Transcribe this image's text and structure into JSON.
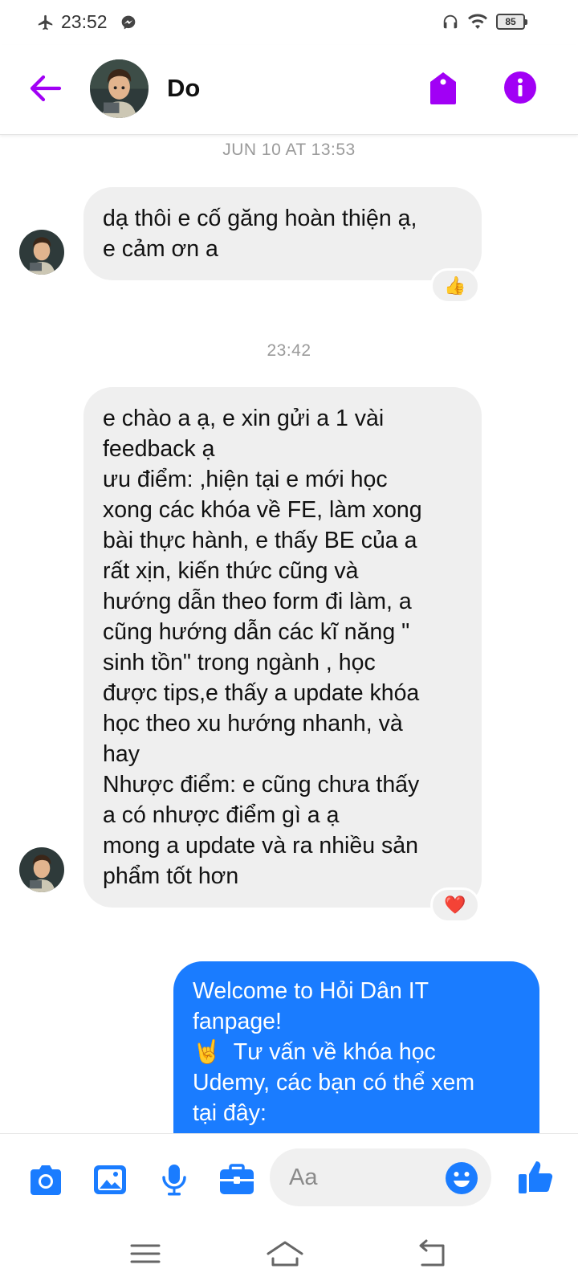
{
  "status_bar": {
    "time": "23:52",
    "battery": "85",
    "icons": [
      "airplane-icon",
      "messenger-icon",
      "headphones-icon",
      "wifi-icon",
      "battery-icon"
    ]
  },
  "header": {
    "contact_name": "Do",
    "accent_color": "#a100f5",
    "icons": [
      "back-arrow-icon",
      "tag-icon",
      "info-icon"
    ]
  },
  "conversation": {
    "timestamp_1": "JUN 10 AT 13:53",
    "message_1": "dạ thôi e cố găng hoàn thiện ạ,\ne cảm ơn a",
    "reaction_1": "👍",
    "timestamp_2": "23:42",
    "message_2": "e chào a ạ, e xin gửi a 1 vài\nfeedback ạ\nưu điểm: ,hiện tại e mới học\nxong các khóa về FE, làm xong\nbài thực hành, e thấy BE của a\nrất xịn, kiến thức cũng và\nhướng dẫn theo form đi làm, a\ncũng hướng dẫn các kĩ năng \"\nsinh tồn\" trong ngành , học\nđược tips,e thấy a update khóa\nhọc theo xu hướng nhanh, và\nhay\nNhược điểm: e cũng chưa thấy\na có nhược điểm gì a ạ\nmong a update và ra nhiều sản\nphẩm tốt hơn",
    "reaction_2": "❤️",
    "message_3": "Welcome to Hỏi Dân IT\nfanpage!\n🤘  Tư vấn về khóa học\nUdemy, các bạn có thể xem\ntại đây:",
    "outgoing_color": "#1a7cff",
    "incoming_color": "#efefef"
  },
  "composer": {
    "placeholder": "Aa",
    "accent_color": "#1a7cff",
    "icons": [
      "camera-icon",
      "gallery-icon",
      "microphone-icon",
      "briefcase-icon",
      "emoji-icon",
      "like-icon"
    ]
  },
  "navbar": {
    "icons": [
      "menu-icon",
      "home-icon",
      "back-icon"
    ]
  }
}
